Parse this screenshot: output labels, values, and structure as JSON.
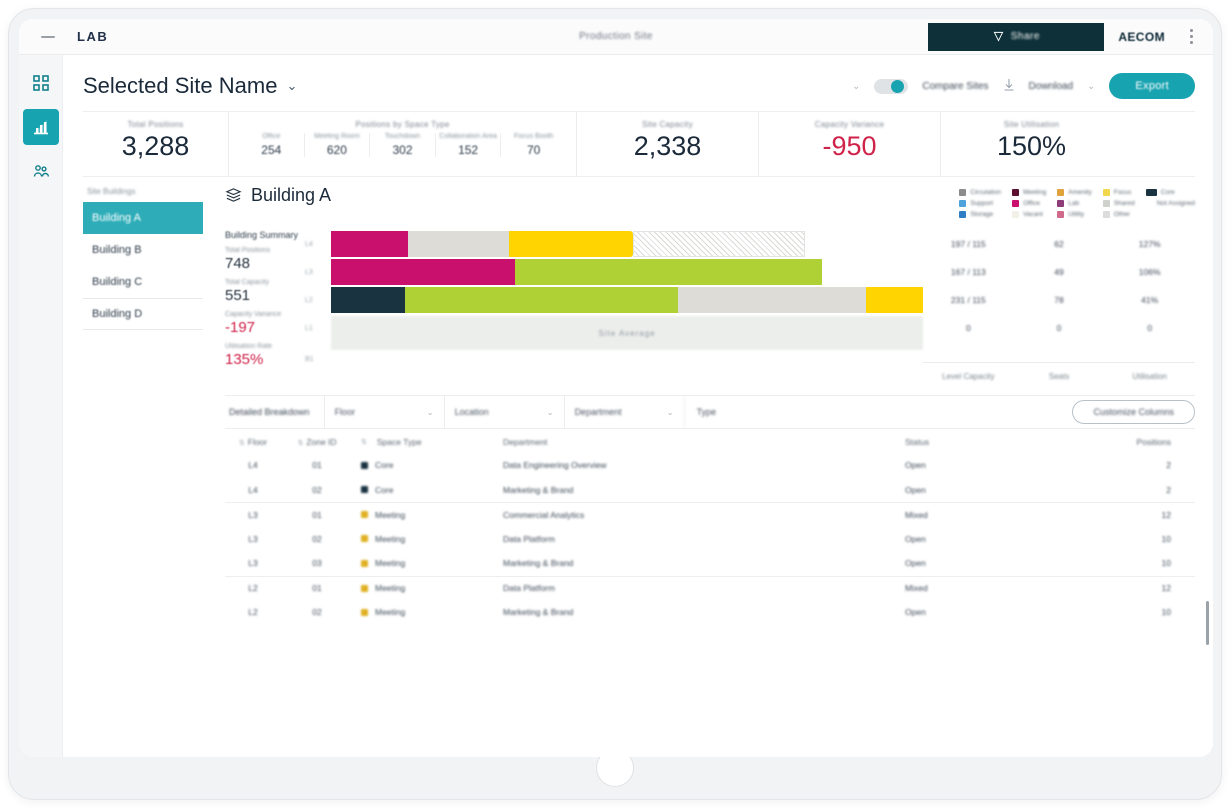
{
  "topbar": {
    "app_label": "LAB",
    "center_title": "Production Site",
    "pill_label": "Share",
    "pill_icon": "share-icon",
    "brand": "AECOM",
    "menu_icon": "kebab-menu-icon"
  },
  "rail": {
    "items": [
      {
        "name": "dashboard-grid",
        "icon": "grid-icon",
        "selected": false
      },
      {
        "name": "analytics",
        "icon": "bar-chart-icon",
        "selected": true
      },
      {
        "name": "people",
        "icon": "people-icon",
        "selected": false
      }
    ]
  },
  "page": {
    "title": "Selected Site Name",
    "caret": "⌄",
    "actions": {
      "left_caret": "⌄",
      "toggle_label": "Compare Sites",
      "download_icon": "download-icon",
      "download_label": "Download",
      "right_caret": "⌄",
      "export_label": "Export"
    }
  },
  "kpis": {
    "total": {
      "label": "Total Positions",
      "value": "3,288"
    },
    "breakdown": {
      "label": "Positions by Space Type",
      "items": [
        {
          "label": "Office",
          "value": "254"
        },
        {
          "label": "Meeting Room",
          "value": "620"
        },
        {
          "label": "Touchdown",
          "value": "302"
        },
        {
          "label": "Collaboration Area",
          "value": "152"
        },
        {
          "label": "Focus Booth",
          "value": "70"
        }
      ]
    },
    "capacity": {
      "label": "Site Capacity",
      "value": "2,338"
    },
    "variance": {
      "label": "Capacity Variance",
      "value": "-950",
      "negative": true
    },
    "utilisation": {
      "label": "Site Utilisation",
      "value": "150%"
    }
  },
  "buildings": {
    "header": "Site Buildings",
    "items": [
      {
        "label": "Building A",
        "selected": true
      },
      {
        "label": "Building B",
        "selected": false
      },
      {
        "label": "Building C",
        "selected": false
      },
      {
        "label": "Building D",
        "selected": false
      }
    ]
  },
  "panel": {
    "title": "Building A",
    "title_icon": "building-icon",
    "subtitle": "Building Summary",
    "stats": [
      {
        "label": "Total Positions",
        "value": "748",
        "negative": false
      },
      {
        "label": "Total Capacity",
        "value": "551",
        "negative": false
      },
      {
        "label": "Capacity Variance",
        "value": "-197",
        "negative": true
      },
      {
        "label": "Utilisation Rate",
        "value": "135%",
        "negative": true
      }
    ]
  },
  "legend": {
    "columns": [
      [
        {
          "color": "#8c8c8c",
          "label": "Circulation"
        },
        {
          "color": "#4ea3dd",
          "label": "Support"
        },
        {
          "color": "#2e7fc6",
          "label": "Storage"
        }
      ],
      [
        {
          "color": "#5b1030",
          "label": "Meeting"
        },
        {
          "color": "#c9106c",
          "label": "Office"
        },
        {
          "color": "#f3f0e8",
          "label": "Vacant"
        }
      ],
      [
        {
          "color": "#e0a23c",
          "label": "Amenity"
        },
        {
          "color": "#8e3d7a",
          "label": "Lab"
        },
        {
          "color": "#d06a8a",
          "label": "Utility"
        }
      ],
      [
        {
          "color": "#f2d64b",
          "label": "Focus"
        },
        {
          "color": "#cfd1cc",
          "label": "Shared"
        },
        {
          "color": "#dcdcdc",
          "label": "Other"
        }
      ],
      [
        {
          "color": "#1a3341",
          "label": "Core"
        },
        {
          "color": "#ffffff",
          "label": "Not Assigned"
        }
      ]
    ]
  },
  "chart_data": {
    "type": "bar",
    "title": "Building A space composition",
    "orientation": "horizontal",
    "stacked": true,
    "xlabel": "",
    "ylabel": "",
    "grid": false,
    "legend_position": "top-right",
    "y_ticks": [
      "L4",
      "L3",
      "L2",
      "L1",
      "B1"
    ],
    "axis_max": 100,
    "series": [
      {
        "name": "Office",
        "color": "#c9106c",
        "values": [
          13,
          31,
          0,
          0,
          0
        ]
      },
      {
        "name": "Core",
        "color": "#1a3341",
        "values": [
          0,
          0,
          13,
          0,
          0
        ]
      },
      {
        "name": "Shared",
        "color": "#dedcd6",
        "values": [
          17,
          0,
          0,
          0,
          0
        ]
      },
      {
        "name": "Focus",
        "color": "#ffd400",
        "values": [
          21,
          0,
          0,
          0,
          0
        ]
      },
      {
        "name": "Vacant",
        "color": "#f4f2ee",
        "values": [
          29,
          0,
          0,
          0,
          0
        ]
      },
      {
        "name": "Amenity",
        "color": "#afd135",
        "values": [
          0,
          52,
          48,
          0,
          0
        ]
      },
      {
        "name": "Support",
        "color": "#dedcd6",
        "values": [
          0,
          0,
          33,
          0,
          0
        ]
      },
      {
        "name": "Utility",
        "color": "#ffd400",
        "values": [
          0,
          0,
          6,
          0,
          0
        ]
      }
    ],
    "rows": [
      {
        "tick": "L4",
        "segments": [
          {
            "name": "Office",
            "color": "#c9106c",
            "width_pct": 13
          },
          {
            "name": "Shared",
            "color": "#dedcd6",
            "width_pct": 17
          },
          {
            "name": "Focus",
            "color": "#ffd400",
            "width_pct": 21
          },
          {
            "name": "Vacant",
            "color": "hatch",
            "width_pct": 29
          }
        ]
      },
      {
        "tick": "L3",
        "segments": [
          {
            "name": "Office",
            "color": "#c9106c",
            "width_pct": 31
          },
          {
            "name": "Amenity",
            "color": "#afd135",
            "width_pct": 52
          }
        ]
      },
      {
        "tick": "L2",
        "segments": [
          {
            "name": "Core",
            "color": "#1a3341",
            "width_pct": 13
          },
          {
            "name": "Amenity",
            "color": "#afd135",
            "width_pct": 48
          },
          {
            "name": "Support",
            "color": "#dedcd6",
            "width_pct": 33
          },
          {
            "name": "Utility",
            "color": "#ffd400",
            "width_pct": 10
          }
        ]
      },
      {
        "tick": "L1",
        "segments": []
      },
      {
        "tick": "B1",
        "segments": []
      }
    ],
    "footer_bar_label": "Site Average",
    "value_table": {
      "rows": [
        {
          "cells": [
            "197 / 115",
            "62",
            "127%"
          ]
        },
        {
          "cells": [
            "167 / 113",
            "49",
            "106%"
          ]
        },
        {
          "cells": [
            "231 / 115",
            "78",
            "41%"
          ]
        },
        {
          "cells": [
            "0",
            "0",
            "0"
          ]
        }
      ],
      "footer": [
        "Level Capacity",
        "Seats",
        "Utilisation"
      ]
    }
  },
  "filters": {
    "title": "Detailed Breakdown",
    "selects": [
      {
        "label": "Floor",
        "caret": "⌄"
      },
      {
        "label": "Location",
        "caret": "⌄"
      },
      {
        "label": "Department",
        "caret": "⌄"
      }
    ],
    "plain": "Type",
    "customize_label": "Customize Columns"
  },
  "table": {
    "columns": [
      {
        "key": "floor",
        "label": "Floor",
        "sortable": true
      },
      {
        "key": "zone",
        "label": "Zone ID",
        "sortable": true
      },
      {
        "key": "type",
        "label": "Space Type",
        "sortable": true
      },
      {
        "key": "dept",
        "label": "Department",
        "sortable": false
      },
      {
        "key": "status",
        "label": "Status",
        "sortable": false
      },
      {
        "key": "seats",
        "label": "Positions",
        "sortable": false
      }
    ],
    "rows": [
      {
        "group_start": false,
        "floor": "L4",
        "zone": "01",
        "dot": "#1a3341",
        "type": "Core",
        "dept": "Data Engineering Overview",
        "status": "Open",
        "seats": "2"
      },
      {
        "group_start": false,
        "floor": "L4",
        "zone": "02",
        "dot": "#1a3341",
        "type": "Core",
        "dept": "Marketing & Brand",
        "status": "Open",
        "seats": "2"
      },
      {
        "group_start": true,
        "floor": "L3",
        "zone": "01",
        "dot": "#e0b020",
        "type": "Meeting",
        "dept": "Commercial Analytics",
        "status": "Mixed",
        "seats": "12"
      },
      {
        "group_start": false,
        "floor": "L3",
        "zone": "02",
        "dot": "#e0b020",
        "type": "Meeting",
        "dept": "Data Platform",
        "status": "Open",
        "seats": "10"
      },
      {
        "group_start": false,
        "floor": "L3",
        "zone": "03",
        "dot": "#e0b020",
        "type": "Meeting",
        "dept": "Marketing & Brand",
        "status": "Open",
        "seats": "10"
      },
      {
        "group_start": true,
        "floor": "L2",
        "zone": "01",
        "dot": "#e0b020",
        "type": "Meeting",
        "dept": "Data Platform",
        "status": "Mixed",
        "seats": "12"
      },
      {
        "group_start": false,
        "floor": "L2",
        "zone": "02",
        "dot": "#e0b020",
        "type": "Meeting",
        "dept": "Marketing & Brand",
        "status": "Open",
        "seats": "10"
      }
    ]
  }
}
